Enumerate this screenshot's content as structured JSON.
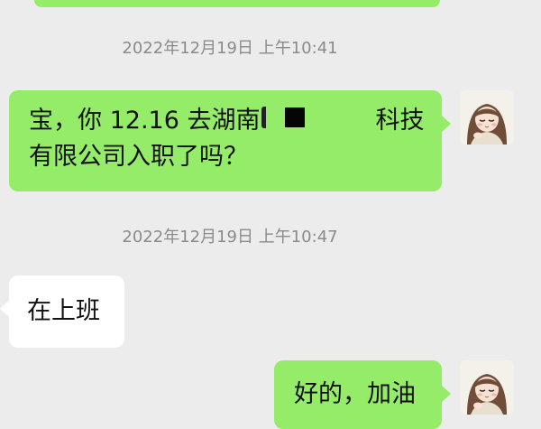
{
  "chat": {
    "messages": [
      {
        "type": "timestamp",
        "text": "2022年12月19日 上午10:41"
      },
      {
        "type": "outgoing",
        "line1_before": "宝，你 12.16 去湖南",
        "line1_after": "科技",
        "line2": "有限公司入职了吗？",
        "has_redaction": true
      },
      {
        "type": "timestamp",
        "text": "2022年12月19日 上午10:47"
      },
      {
        "type": "incoming",
        "text": "在上班"
      },
      {
        "type": "outgoing",
        "text": "好的，加油"
      }
    ]
  },
  "sender": {
    "avatar_icon": "avatar-girl-illustration-icon"
  },
  "colors": {
    "background": "#ececec",
    "outgoing_bubble": "#95ec69",
    "incoming_bubble": "#ffffff",
    "timestamp_text": "#8a8a8a"
  }
}
